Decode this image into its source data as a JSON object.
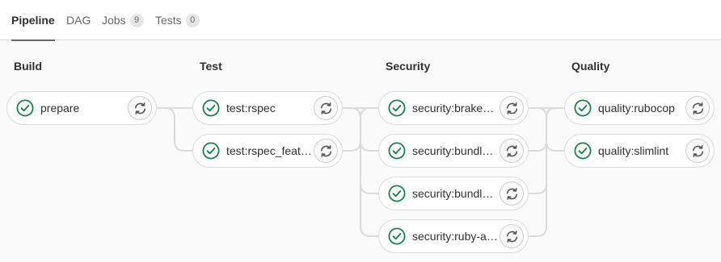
{
  "tabs": [
    {
      "label": "Pipeline",
      "count": null,
      "active": true
    },
    {
      "label": "DAG",
      "count": null,
      "active": false
    },
    {
      "label": "Jobs",
      "count": "9",
      "active": false
    },
    {
      "label": "Tests",
      "count": "0",
      "active": false
    }
  ],
  "status_color": "#108548",
  "stages": [
    {
      "title": "Build",
      "jobs": [
        {
          "name": "prepare",
          "status": "passed-icon",
          "action": "retry-icon"
        }
      ]
    },
    {
      "title": "Test",
      "jobs": [
        {
          "name": "test:rspec",
          "status": "passed-icon",
          "action": "retry-icon"
        },
        {
          "name": "test:rspec_featu...",
          "status": "passed-icon",
          "action": "retry-icon"
        }
      ]
    },
    {
      "title": "Security",
      "jobs": [
        {
          "name": "security:brakem...",
          "status": "passed-icon",
          "action": "retry-icon"
        },
        {
          "name": "security:bundle-...",
          "status": "passed-icon",
          "action": "retry-icon"
        },
        {
          "name": "security:bundle-...",
          "status": "passed-icon",
          "action": "retry-icon"
        },
        {
          "name": "security:ruby-au...",
          "status": "passed-icon",
          "action": "retry-icon"
        }
      ]
    },
    {
      "title": "Quality",
      "jobs": [
        {
          "name": "quality:rubocop",
          "status": "passed-icon",
          "action": "retry-icon"
        },
        {
          "name": "quality:slimlint",
          "status": "passed-icon",
          "action": "retry-icon"
        }
      ]
    }
  ]
}
